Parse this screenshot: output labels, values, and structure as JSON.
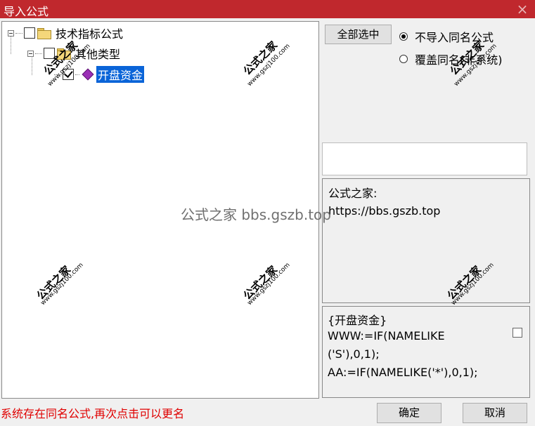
{
  "window": {
    "title": "导入公式",
    "close_icon": "×"
  },
  "tree": {
    "root": {
      "label": "技术指标公式",
      "checked": false
    },
    "child": {
      "label": "其他类型",
      "checked": false
    },
    "leaf": {
      "label": "开盘资金",
      "checked": true
    }
  },
  "options": {
    "select_all_label": "全部选中",
    "radio_skip_label": "不导入同名公式",
    "radio_overwrite_label": "覆盖同名(非系统)",
    "selected": "skip"
  },
  "description": {
    "line1": "公式之家:",
    "line2": "https://bbs.gszb.top"
  },
  "code": {
    "lines": [
      "{开盘资金}",
      "WWW:=IF(NAMELIKE",
      "('S'),0,1);",
      "AA:=IF(NAMELIKE('*'),0,1);"
    ]
  },
  "status": "系统存在同名公式,再次点击可以更名",
  "buttons": {
    "ok": "确定",
    "cancel": "取消"
  },
  "watermarks": {
    "stamp_text": "公式之家",
    "stamp_url": "www.gszj100.com",
    "overlay": "公式之家 bbs.gszb.top"
  }
}
